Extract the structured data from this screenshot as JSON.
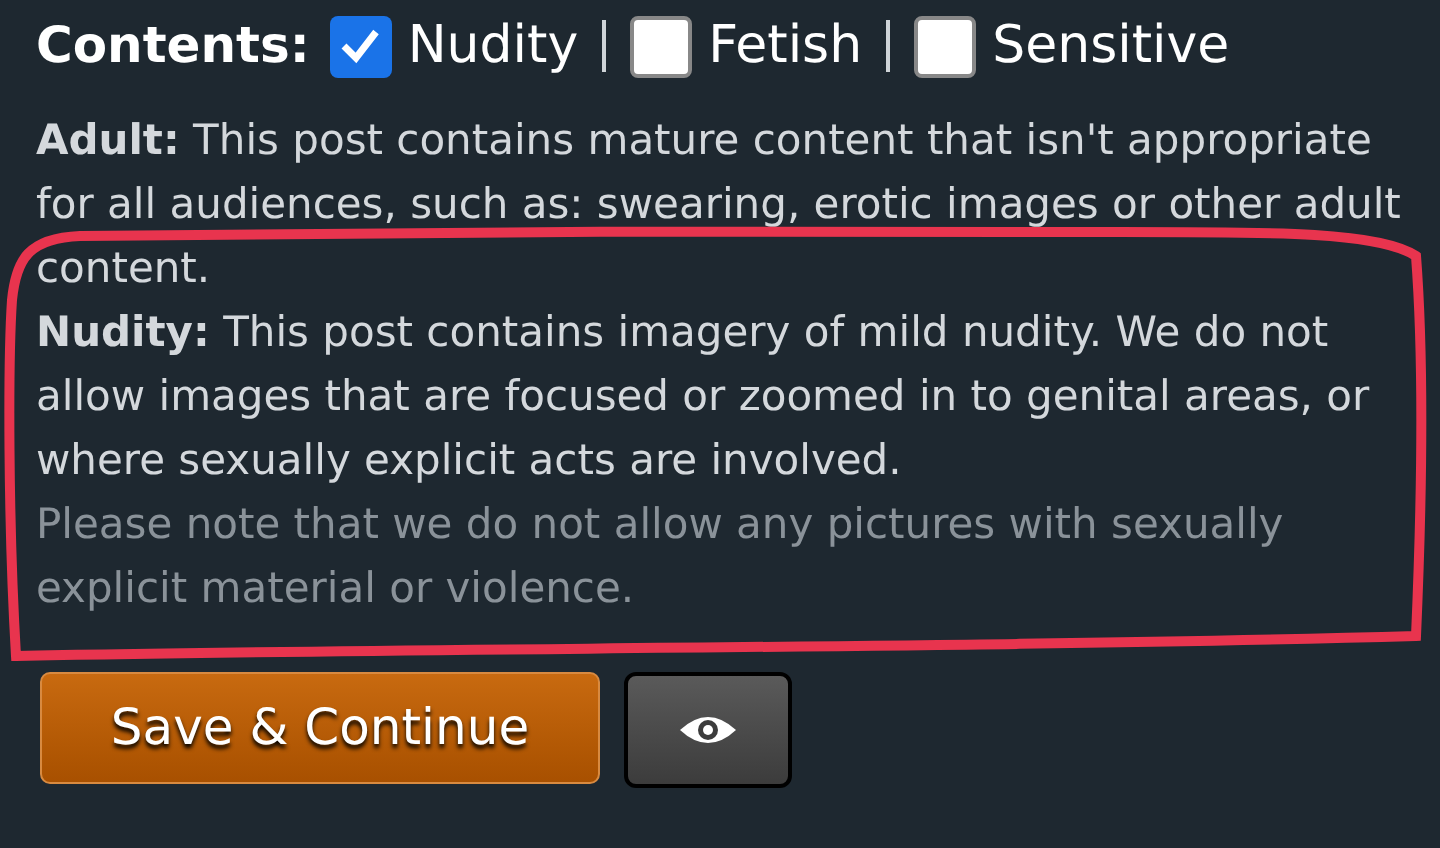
{
  "contents": {
    "label": "Contents:",
    "options": [
      {
        "label": "Nudity",
        "checked": true
      },
      {
        "label": "Fetish",
        "checked": false
      },
      {
        "label": "Sensitive",
        "checked": false
      }
    ]
  },
  "descriptions": [
    {
      "kind": "rating",
      "text": "**Adult:** This post contains mature content that isn't appropriate for all audiences, such as: swearing, erotic images or other adult content."
    },
    {
      "kind": "rating",
      "text": "**Nudity:** This post contains imagery of mild nudity. We do not allow images that are focused or zoomed in to genital areas, or where sexually explicit acts are involved."
    },
    {
      "kind": "note",
      "text": "Please note that we do not allow any pictures with sexually explicit material or violence."
    }
  ],
  "buttons": {
    "save": "Save & Continue"
  }
}
